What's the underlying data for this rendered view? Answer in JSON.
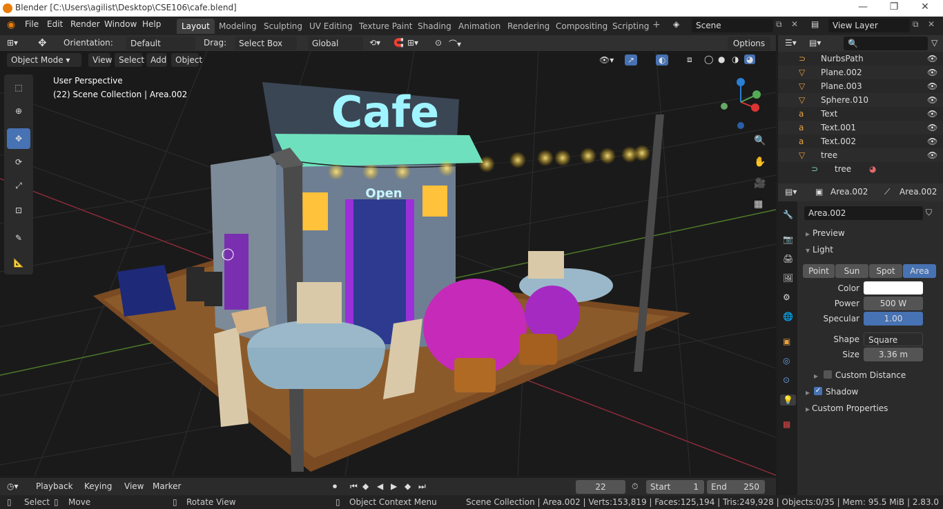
{
  "window": {
    "title": "Blender [C:\\Users\\agilist\\Desktop\\CSE106\\cafe.blend]"
  },
  "menubar": {
    "items": [
      "File",
      "Edit",
      "Render",
      "Window",
      "Help"
    ]
  },
  "workspaces": {
    "tabs": [
      "Layout",
      "Modeling",
      "Sculpting",
      "UV Editing",
      "Texture Paint",
      "Shading",
      "Animation",
      "Rendering",
      "Compositing",
      "Scripting"
    ],
    "active": "Layout"
  },
  "scene": {
    "name": "Scene",
    "view_layer": "View Layer"
  },
  "tool_header": {
    "orientation_label": "Orientation:",
    "orientation_value": "Default",
    "drag_label": "Drag:",
    "drag_value": "Select Box",
    "transform_value": "Global",
    "options_label": "Options"
  },
  "viewport_header": {
    "mode": "Object Mode",
    "view": "View",
    "select": "Select",
    "add": "Add",
    "object": "Object"
  },
  "viewport": {
    "perspective": "User Perspective",
    "collection_info": "(22) Scene Collection | Area.002",
    "scene_sign_text": "Cafe",
    "open_sign_text": "Open"
  },
  "outliner": {
    "items": [
      {
        "name": "NurbsPath",
        "icon": "curve-icon"
      },
      {
        "name": "Plane.002",
        "icon": "mesh-icon"
      },
      {
        "name": "Plane.003",
        "icon": "mesh-icon"
      },
      {
        "name": "Sphere.010",
        "icon": "mesh-icon"
      },
      {
        "name": "Text",
        "icon": "text-icon"
      },
      {
        "name": "Text.001",
        "icon": "text-icon"
      },
      {
        "name": "Text.002",
        "icon": "text-icon"
      },
      {
        "name": "tree",
        "icon": "mesh-icon"
      },
      {
        "name": "tree",
        "icon": "curve-icon"
      }
    ]
  },
  "properties": {
    "object_name": "Area.002",
    "data_name": "Area.002",
    "datablock": "Area.002",
    "preview_label": "Preview",
    "light_label": "Light",
    "light_types": [
      "Point",
      "Sun",
      "Spot",
      "Area"
    ],
    "active_type": "Area",
    "color_label": "Color",
    "power_label": "Power",
    "power_value": "500 W",
    "specular_label": "Specular",
    "specular_value": "1.00",
    "shape_label": "Shape",
    "shape_value": "Square",
    "size_label": "Size",
    "size_value": "3.36 m",
    "custom_distance_label": "Custom Distance",
    "shadow_label": "Shadow",
    "custom_props_label": "Custom Properties"
  },
  "timeline": {
    "playback": "Playback",
    "keying": "Keying",
    "view": "View",
    "marker": "Marker",
    "current_frame": "22",
    "start_label": "Start",
    "start_value": "1",
    "end_label": "End",
    "end_value": "250"
  },
  "statusbar": {
    "select": "Select",
    "move": "Move",
    "rotate": "Rotate View",
    "context": "Object Context Menu",
    "stats": "Scene Collection | Area.002 | Verts:153,819 | Faces:125,194 | Tris:249,928 | Objects:0/35 | Mem: 95.5 MiB | 2.83.0"
  },
  "colors": {
    "accent": "#4772b3",
    "light_color": "#ffffff"
  }
}
